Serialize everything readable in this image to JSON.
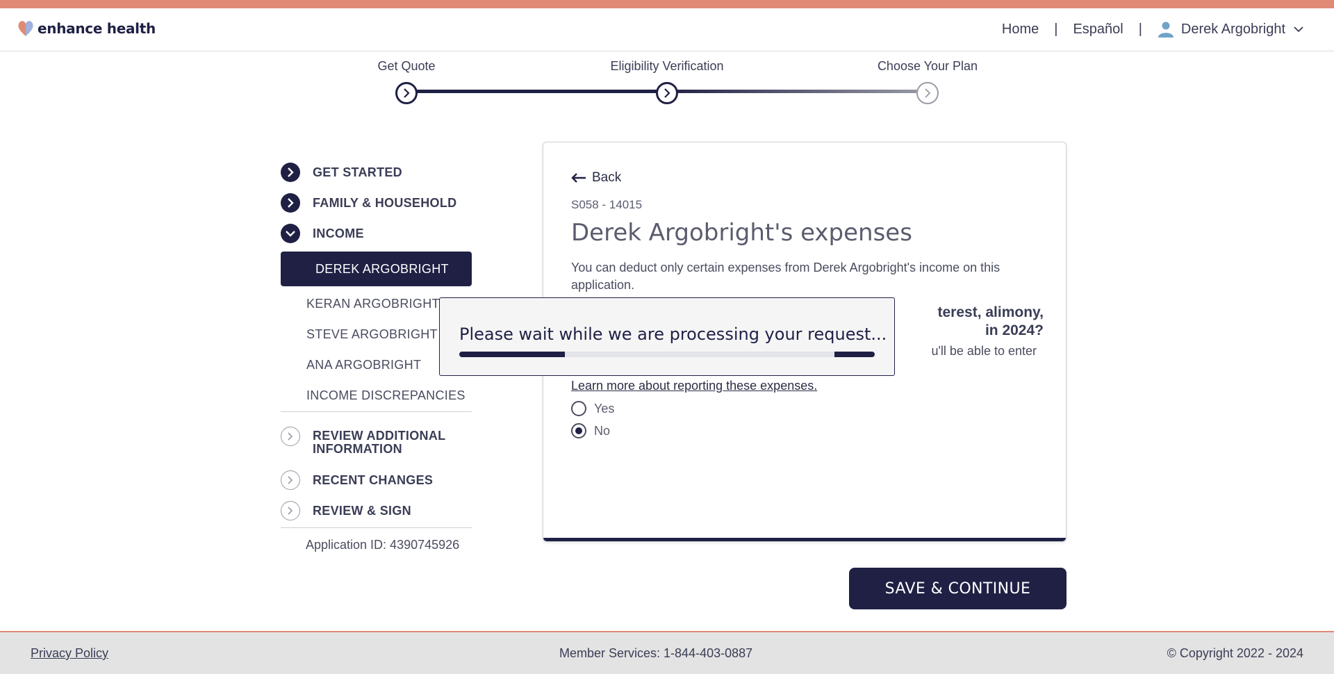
{
  "colors": {
    "brand_navy": "#1f2044",
    "accent_coral": "#e08a76",
    "footer_bg": "#e3e3e3"
  },
  "header": {
    "logo_text": "enhance health",
    "nav": {
      "home": "Home",
      "language": "Español",
      "user_name": "Derek Argobright",
      "separator": "|"
    }
  },
  "stepper": {
    "steps": [
      {
        "label": "Get Quote",
        "status": "complete"
      },
      {
        "label": "Eligibility Verification",
        "status": "current"
      },
      {
        "label": "Choose Your Plan",
        "status": "upcoming"
      }
    ]
  },
  "sidebar": {
    "sections": [
      {
        "label": "GET STARTED",
        "icon": "chevron-right-icon"
      },
      {
        "label": "FAMILY & HOUSEHOLD",
        "icon": "chevron-right-icon"
      },
      {
        "label": "INCOME",
        "icon": "chevron-down-icon"
      },
      {
        "label": "REVIEW ADDITIONAL INFORMATION",
        "icon": "chevron-right-icon"
      },
      {
        "label": "RECENT CHANGES",
        "icon": "chevron-right-icon"
      },
      {
        "label": "REVIEW & SIGN",
        "icon": "chevron-right-icon"
      }
    ],
    "income_subitems": [
      "DEREK ARGOBRIGHT",
      "KERAN ARGOBRIGHT",
      "STEVE ARGOBRIGHT",
      "ANA ARGOBRIGHT",
      "INCOME DISCREPANCIES"
    ],
    "review_line1": "REVIEW ADDITIONAL",
    "review_line2": "INFORMATION",
    "application_id": "Application ID: 4390745926"
  },
  "main": {
    "back_label": "Back",
    "code": "S058 - 14015",
    "title": "Derek Argobright's expenses",
    "description": "You can deduct only certain expenses from Derek Argobright's income on this application.",
    "question_line1": "terest, alimony,",
    "question_line2": "in 2024?",
    "helper_text": "u'll be able to enter",
    "learn_more": "Learn more about reporting these expenses.",
    "options": [
      {
        "label": "Yes",
        "selected": false
      },
      {
        "label": "No",
        "selected": true
      }
    ],
    "save_button": "SAVE & CONTINUE"
  },
  "loading": {
    "message": "Please wait while we are processing your request..."
  },
  "footer": {
    "privacy": "Privacy Policy",
    "member_services": "Member Services: 1-844-403-0887",
    "copyright": "© Copyright 2022 - 2024"
  }
}
